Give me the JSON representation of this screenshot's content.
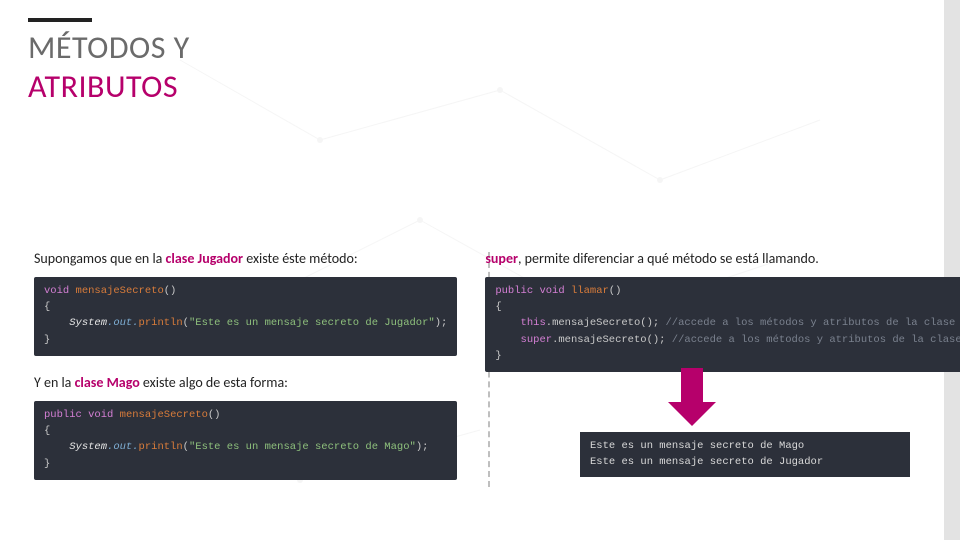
{
  "title": {
    "line1": "MÉTODOS Y",
    "line2": "ATRIBUTOS"
  },
  "left": {
    "para1_pre": "Supongamos que en la ",
    "para1_hl": "clase Jugador",
    "para1_post": " existe éste método:",
    "code1": {
      "kw_void": "void",
      "fn": "mensajeSecreto",
      "sysout_cls": "System",
      "sysout_mem": ".out.",
      "println": "println",
      "str": "\"Este es un mensaje secreto de Jugador\""
    },
    "para2_pre": "Y en la ",
    "para2_hl": "clase Mago",
    "para2_post": " existe algo de esta forma:",
    "code2": {
      "kw_pub": "public",
      "kw_void": "void",
      "fn": "mensajeSecreto",
      "sysout_cls": "System",
      "sysout_mem": ".out.",
      "println": "println",
      "str": "\"Este es un mensaje secreto de Mago\""
    }
  },
  "right": {
    "para_hl": "super",
    "para_post": ", permite diferenciar a qué método se está llamando.",
    "code": {
      "kw_pub": "public",
      "kw_void": "void",
      "fn": "llamar",
      "this": "this",
      "call": ".mensajeSecreto();",
      "cmt1": "//accede a los métodos y atributos de la clase actual.",
      "super": "super",
      "call2": ".mensajeSecreto();",
      "cmt2": "//accede a los métodos y atributos de la clase padre."
    },
    "output_l1": "Este es un mensaje secreto de Mago",
    "output_l2": "Este es un mensaje secreto de Jugador"
  }
}
